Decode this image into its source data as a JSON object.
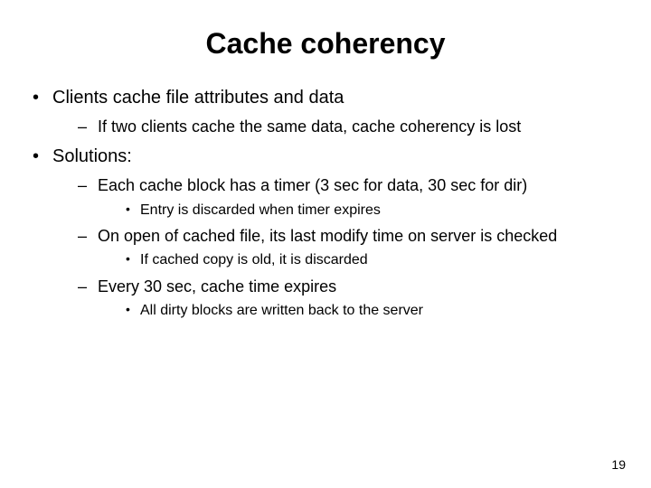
{
  "title": "Cache coherency",
  "bullets": {
    "b1": "Clients cache file attributes and data",
    "b1_1": "If two clients cache the same data, cache coherency is lost",
    "b2": "Solutions:",
    "b2_1": "Each cache block has a timer (3 sec for data, 30 sec for dir)",
    "b2_1_1": "Entry is discarded when timer expires",
    "b2_2": "On open of cached file, its last modify time on server is checked",
    "b2_2_1": "If cached copy is old, it is discarded",
    "b2_3": "Every 30 sec, cache time expires",
    "b2_3_1": "All dirty blocks are written back to the server"
  },
  "page_number": "19"
}
